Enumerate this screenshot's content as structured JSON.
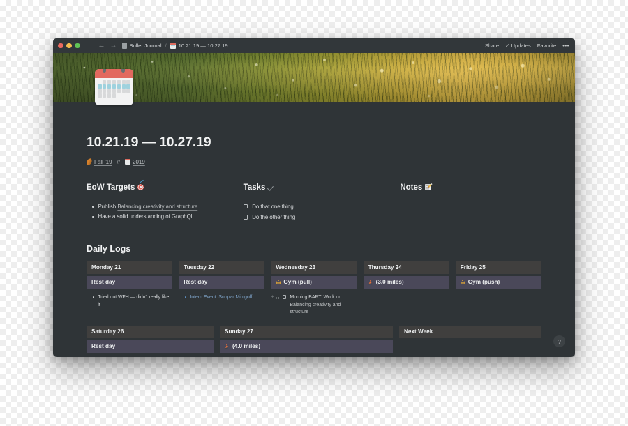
{
  "titlebar": {
    "window_controls": [
      "close",
      "minimize",
      "zoom"
    ],
    "menu_icon": "hamburger-icon",
    "back_label": "←",
    "forward_label": "→",
    "breadcrumb": {
      "workspace_icon": "book-icon",
      "workspace": "Bullet Journal",
      "separator": "/",
      "page_icon": "calendar-icon",
      "page": "10.21.19 — 10.27.19"
    },
    "actions": {
      "share": "Share",
      "updates": "Updates",
      "updates_icon": "check-icon",
      "favorite": "Favorite",
      "more": "•••"
    }
  },
  "page": {
    "icon": "calendar-emoji",
    "title": "10.21.19 — 10.27.19",
    "breadcrumbs": [
      {
        "icon": "leaf-icon",
        "label": "Fall '19"
      },
      {
        "icon": "calendar-icon",
        "label": "2019"
      }
    ],
    "breadcrumb_separator": "//"
  },
  "columns": [
    {
      "title": "EoW Targets",
      "icon": "dart-target-icon",
      "items": [
        {
          "prefix": "Publish ",
          "link": "Balancing creativity and structure"
        },
        {
          "prefix": "Have a solid understanding of GraphQL",
          "link": ""
        }
      ]
    },
    {
      "title": "Tasks",
      "icon": "checkmark-icon",
      "tasks": [
        {
          "label": "Do that one thing",
          "checked": false
        },
        {
          "label": "Do the other thing",
          "checked": false
        }
      ]
    },
    {
      "title": "Notes",
      "icon": "memo-icon",
      "items": []
    }
  ],
  "daily_logs": {
    "title": "Daily Logs",
    "week": [
      {
        "day": "Monday 21",
        "activity": "Rest day",
        "activity_icon": "",
        "notes": [
          {
            "type": "bullet",
            "text": "Tried out WFH — didn't really like it"
          }
        ]
      },
      {
        "day": "Tuesday 22",
        "activity": "Rest day",
        "activity_icon": "",
        "notes": [
          {
            "type": "link",
            "text": "Intern Event: Subpar Minigolf"
          }
        ]
      },
      {
        "day": "Wednesday 23",
        "activity": "Gym (pull)",
        "activity_icon": "weightlifter-icon",
        "notes": [
          {
            "type": "todo",
            "hovered": true,
            "text": "Morning BART: Work on ",
            "link": "Balancing creativity and structure"
          }
        ]
      },
      {
        "day": "Thursday 24",
        "activity": "(3.0 miles)",
        "activity_icon": "runner-icon",
        "notes": []
      },
      {
        "day": "Friday 25",
        "activity": "Gym (push)",
        "activity_icon": "weightlifter-icon",
        "notes": []
      }
    ],
    "weekend": [
      {
        "day": "Saturday 26",
        "activity": "Rest day",
        "activity_icon": ""
      },
      {
        "day": "Sunday 27",
        "activity": "(4.0 miles)",
        "activity_icon": "runner-icon"
      },
      {
        "day": "Next Week",
        "activity": "",
        "activity_icon": ""
      }
    ]
  },
  "help": {
    "label": "?"
  },
  "colors": {
    "app_background": "#2f3437",
    "titlebar": "#32373a",
    "day_header": "#403f3e",
    "day_activity": "#4a4859",
    "link_blue": "#7fa4c9",
    "text_primary": "#e7e9ea"
  }
}
